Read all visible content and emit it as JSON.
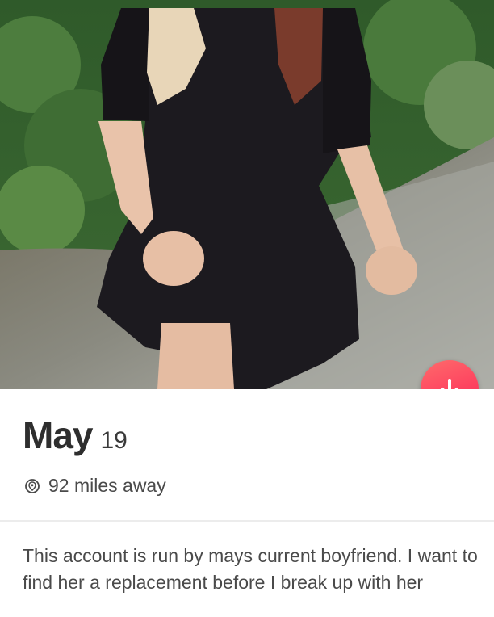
{
  "profile": {
    "name": "May",
    "age": "19",
    "distance": "92 miles away",
    "bio": "This account is run by mays current boyfriend. I want to find her a replacement before I break up with her"
  },
  "icons": {
    "location": "location-pin-icon",
    "more_info": "arrow-down-icon"
  },
  "colors": {
    "accent": "#fd3f5f",
    "name_text": "#2e2e2e",
    "body_text": "#4a4a4a"
  }
}
